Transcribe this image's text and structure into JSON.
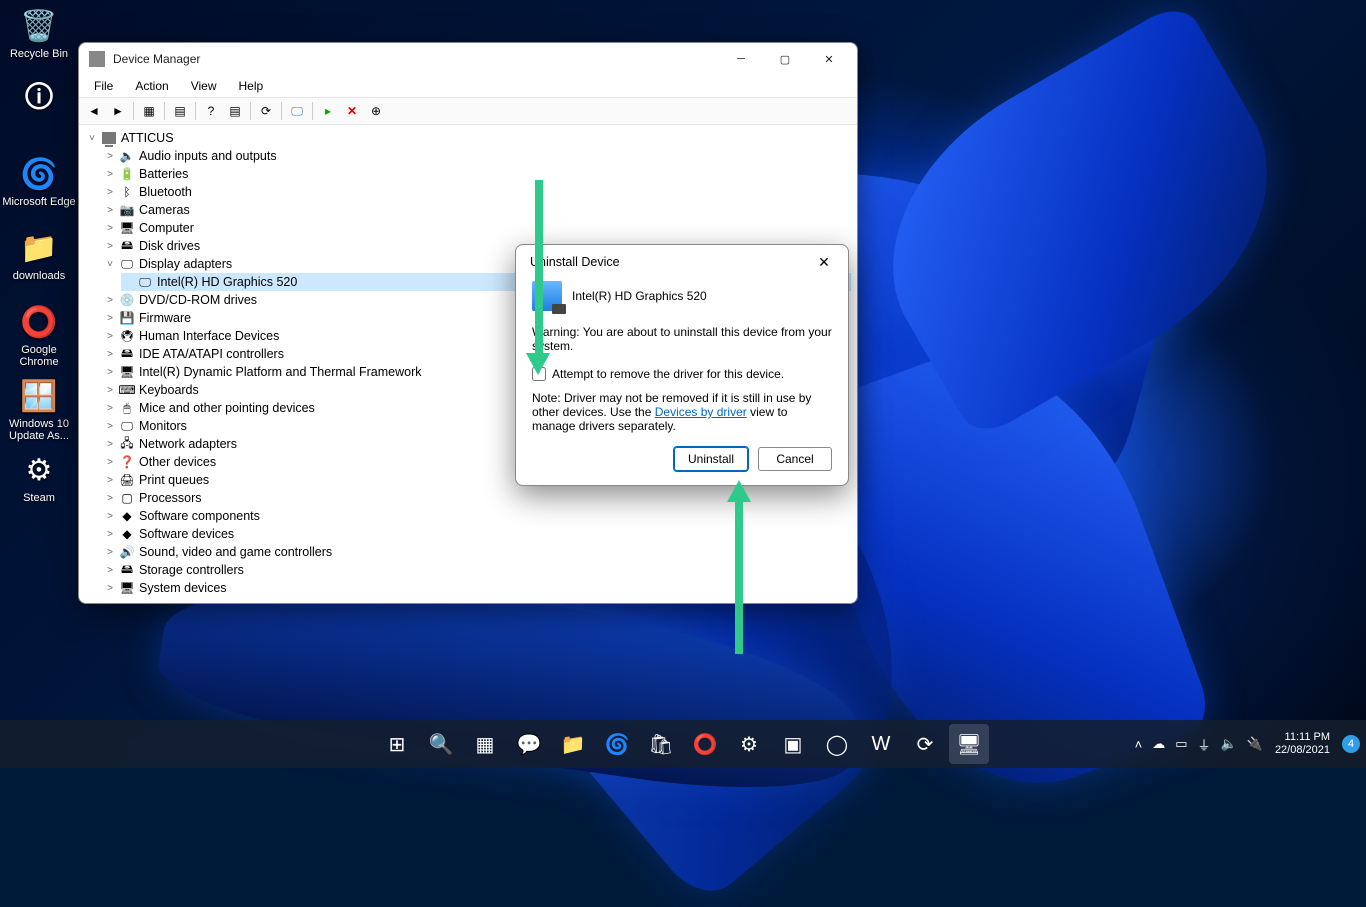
{
  "desktop": {
    "icons": [
      {
        "name": "recycle-bin",
        "label": "Recycle Bin",
        "glyph": "🗑️"
      },
      {
        "name": "hwinfo",
        "label": "",
        "glyph": "🛈"
      },
      {
        "name": "edge",
        "label": "Microsoft Edge",
        "glyph": "🌀"
      },
      {
        "name": "downloads",
        "label": "downloads",
        "glyph": "📁"
      },
      {
        "name": "chrome",
        "label": "Google Chrome",
        "glyph": "⭕"
      },
      {
        "name": "win10-update",
        "label": "Windows 10 Update As...",
        "glyph": "🪟"
      },
      {
        "name": "steam",
        "label": "Steam",
        "glyph": "⚙"
      }
    ]
  },
  "window": {
    "title": "Device Manager",
    "menus": [
      "File",
      "Action",
      "View",
      "Help"
    ],
    "tree_root": "ATTICUS",
    "categories": [
      {
        "label": "Audio inputs and outputs",
        "icon": "🔈"
      },
      {
        "label": "Batteries",
        "icon": "🔋"
      },
      {
        "label": "Bluetooth",
        "icon": "ᛒ"
      },
      {
        "label": "Cameras",
        "icon": "📷"
      },
      {
        "label": "Computer",
        "icon": "🖥"
      },
      {
        "label": "Disk drives",
        "icon": "🖴"
      },
      {
        "label": "Display adapters",
        "icon": "🖵",
        "expanded": true,
        "children": [
          {
            "label": "Intel(R) HD Graphics 520",
            "icon": "🖵",
            "selected": true
          }
        ]
      },
      {
        "label": "DVD/CD-ROM drives",
        "icon": "💿"
      },
      {
        "label": "Firmware",
        "icon": "💾"
      },
      {
        "label": "Human Interface Devices",
        "icon": "🖲"
      },
      {
        "label": "IDE ATA/ATAPI controllers",
        "icon": "🖴"
      },
      {
        "label": "Intel(R) Dynamic Platform and Thermal Framework",
        "icon": "🖥"
      },
      {
        "label": "Keyboards",
        "icon": "⌨"
      },
      {
        "label": "Mice and other pointing devices",
        "icon": "🖱"
      },
      {
        "label": "Monitors",
        "icon": "🖵"
      },
      {
        "label": "Network adapters",
        "icon": "🖧"
      },
      {
        "label": "Other devices",
        "icon": "❓"
      },
      {
        "label": "Print queues",
        "icon": "🖨"
      },
      {
        "label": "Processors",
        "icon": "▢"
      },
      {
        "label": "Software components",
        "icon": "◆"
      },
      {
        "label": "Software devices",
        "icon": "◆"
      },
      {
        "label": "Sound, video and game controllers",
        "icon": "🔊"
      },
      {
        "label": "Storage controllers",
        "icon": "🖴"
      },
      {
        "label": "System devices",
        "icon": "🖥"
      }
    ]
  },
  "dialog": {
    "title": "Uninstall Device",
    "device": "Intel(R) HD Graphics 520",
    "warning": "Warning: You are about to uninstall this device from your system.",
    "checkbox": "Attempt to remove the driver for this device.",
    "note_pre": "Note: Driver may not be removed if it is still in use by other devices. Use the ",
    "note_link": "Devices by driver",
    "note_post": " view to manage drivers separately.",
    "btn_primary": "Uninstall",
    "btn_cancel": "Cancel"
  },
  "taskbar": {
    "items": [
      {
        "name": "start",
        "glyph": "⊞"
      },
      {
        "name": "search",
        "glyph": "🔍"
      },
      {
        "name": "taskview",
        "glyph": "▦"
      },
      {
        "name": "chat",
        "glyph": "💬"
      },
      {
        "name": "explorer",
        "glyph": "📁"
      },
      {
        "name": "edge",
        "glyph": "🌀"
      },
      {
        "name": "store",
        "glyph": "🛍"
      },
      {
        "name": "chrome",
        "glyph": "⭕"
      },
      {
        "name": "settings",
        "glyph": "⚙"
      },
      {
        "name": "nvidia",
        "glyph": "▣"
      },
      {
        "name": "opera",
        "glyph": "◯"
      },
      {
        "name": "word",
        "glyph": "W"
      },
      {
        "name": "steam",
        "glyph": "⟳"
      },
      {
        "name": "devmgr",
        "glyph": "🖥",
        "active": true
      }
    ],
    "time": "11:11 PM",
    "date": "22/08/2021",
    "notif_count": "4"
  }
}
